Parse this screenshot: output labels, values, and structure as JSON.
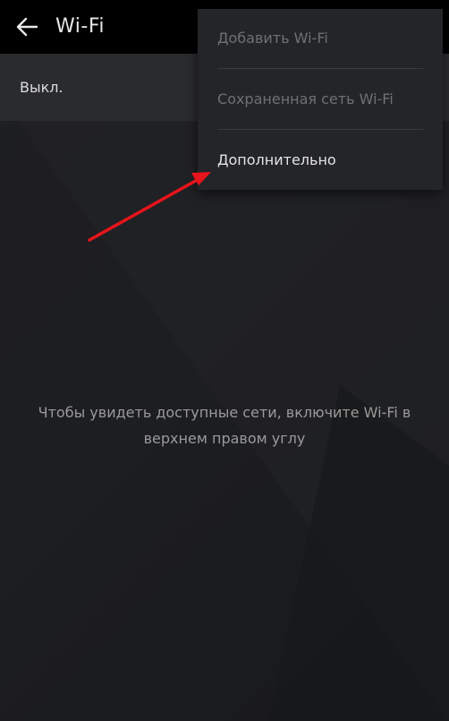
{
  "header": {
    "title": "Wi-Fi",
    "back_icon": "arrow-left-icon"
  },
  "wifi": {
    "status_label": "Выкл."
  },
  "empty_state": {
    "message": "Чтобы увидеть доступные сети, включите Wi-Fi в верхнем правом углу"
  },
  "menu": {
    "items": [
      {
        "label": "Добавить Wi-Fi",
        "enabled": false
      },
      {
        "label": "Сохраненная сеть Wi-Fi",
        "enabled": false
      },
      {
        "label": "Дополнительно",
        "enabled": true
      }
    ]
  },
  "annotation": {
    "arrow_color": "#e8141b"
  },
  "colors": {
    "topbar": "#000000",
    "status_row": "#2a2b2e",
    "menu_background": "#242528",
    "disabled_text": "#6f7073"
  }
}
